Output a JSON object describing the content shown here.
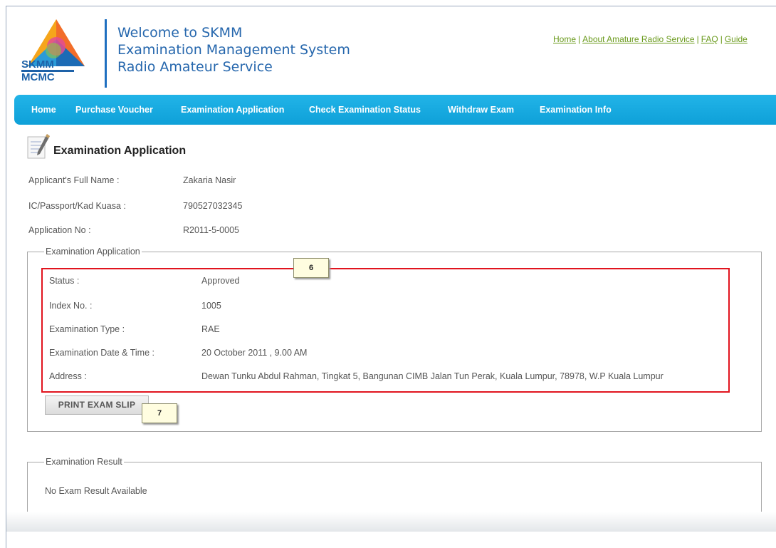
{
  "header": {
    "logo_line1": "SKMM",
    "logo_line2": "MCMC",
    "title_line1": "Welcome to SKMM",
    "title_line2": "Examination Management System",
    "title_line3": "Radio Amateur Service",
    "links": {
      "home": "Home",
      "about": "About Amature Radio Service",
      "faq": "FAQ",
      "guide": "Guide",
      "separator": "|"
    }
  },
  "nav": {
    "items": [
      "Home",
      "Purchase Voucher",
      "Examination Application",
      "Check Examination Status",
      "Withdraw Exam",
      "Examination Info"
    ]
  },
  "page": {
    "title": "Examination Application",
    "applicant_name_label": "Applicant's Full Name :",
    "applicant_name": "Zakaria Nasir",
    "ic_label": "IC/Passport/Kad Kuasa :",
    "ic_value": "790527032345",
    "app_no_label": "Application No :",
    "app_no_value": "R2011-5-0005"
  },
  "exam_application": {
    "legend": "Examination Application",
    "status_label": "Status :",
    "status_value": "Approved",
    "index_label": "Index No. :",
    "index_value": "1005",
    "type_label": "Examination Type :",
    "type_value": "RAE",
    "date_label": "Examination Date & Time :",
    "date_value": "20 October 2011 , 9.00 AM",
    "address_label": "Address :",
    "address_value": "Dewan Tunku Abdul Rahman, Tingkat 5, Bangunan CIMB Jalan Tun Perak, Kuala Lumpur, 78978, W.P Kuala Lumpur",
    "print_button": "PRINT EXAM SLIP"
  },
  "callouts": {
    "first": "6",
    "second": "7"
  },
  "exam_result": {
    "legend": "Examination Result",
    "message": "No Exam Result Available"
  },
  "colors": {
    "nav_bg": "#1aaee4",
    "title_blue": "#2667ad",
    "link_green": "#6a9a1c",
    "highlight_red": "#e1141e"
  }
}
